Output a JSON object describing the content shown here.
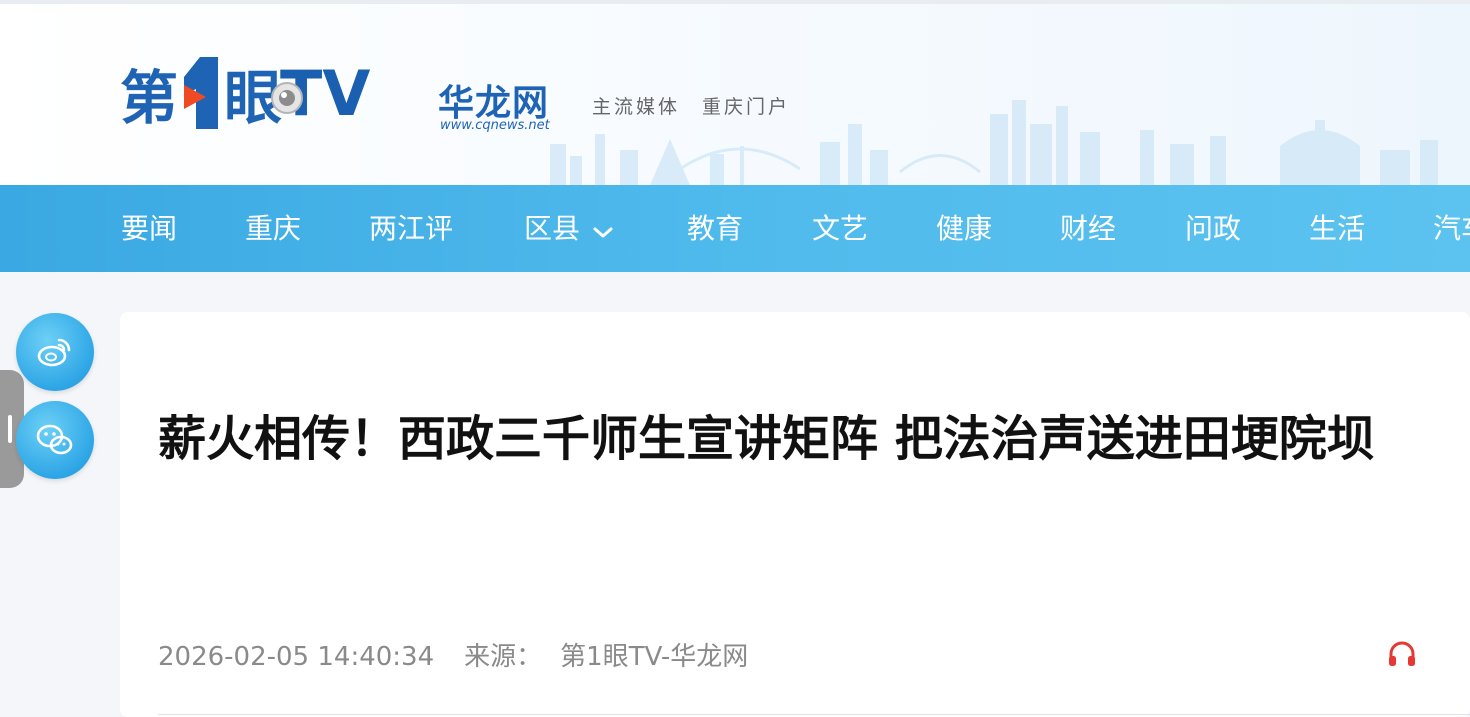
{
  "brand": {
    "logo_text": "第1眼TV",
    "site_name": "华龙网",
    "site_url": "www.cqnews.net",
    "slogan_left": "主流媒体",
    "slogan_right": "重庆门户"
  },
  "nav": {
    "items": [
      {
        "label": "要闻"
      },
      {
        "label": "重庆"
      },
      {
        "label": "两江评"
      },
      {
        "label": "区县",
        "has_dropdown": true
      },
      {
        "label": "教育"
      },
      {
        "label": "文艺"
      },
      {
        "label": "健康"
      },
      {
        "label": "财经"
      },
      {
        "label": "问政"
      },
      {
        "label": "生活"
      },
      {
        "label": "汽车"
      }
    ]
  },
  "article": {
    "title": "薪火相传！西政三千师生宣讲矩阵 把法治声送进田埂院坝",
    "datetime": "2026-02-05 14:40:34",
    "source_label": "来源：",
    "source": "第1眼TV-华龙网"
  },
  "share": {
    "icons": [
      "weibo-icon",
      "wechat-icon"
    ]
  },
  "colors": {
    "brand_blue": "#1f64b4",
    "nav_blue": "#4fbaec",
    "logo_accent": "#f04a23",
    "headphone_red": "#e53935"
  }
}
